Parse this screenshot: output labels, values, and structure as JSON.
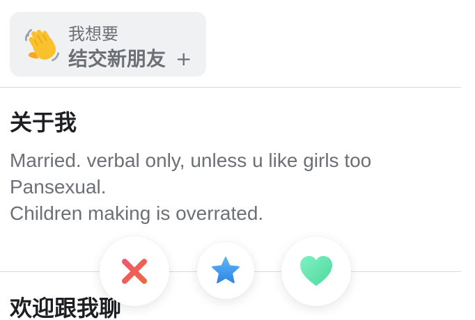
{
  "intent": {
    "label": "我想要",
    "value": "结交新朋友",
    "add_symbol": "+",
    "icon": "waving-hand-icon"
  },
  "about": {
    "title": "关于我",
    "bio_lines": [
      "Married. verbal only, unless u like girls too",
      "Pansexual.",
      "Children making is overrated."
    ]
  },
  "next_section": {
    "title": "欢迎跟我聊"
  },
  "actions": {
    "nope_icon": "close-x-icon",
    "super_like_icon": "star-icon",
    "like_icon": "heart-icon"
  },
  "colors": {
    "nope_gradient": [
      "#f5556b",
      "#e96a45"
    ],
    "super_like_gradient": [
      "#5fb4f6",
      "#2f86e4"
    ],
    "like_gradient": [
      "#7ff0c4",
      "#4fd99c"
    ]
  }
}
